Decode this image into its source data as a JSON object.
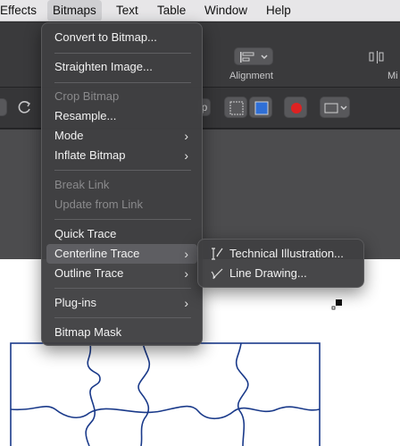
{
  "menubar": {
    "items": [
      "Effects",
      "Bitmaps",
      "Text",
      "Table",
      "Window",
      "Help"
    ]
  },
  "toolbar": {
    "alignment_label": "Alignment",
    "partial_label": "Mi",
    "partial_p": "p"
  },
  "bitmaps_menu": {
    "convert": "Convert to Bitmap...",
    "straighten": "Straighten Image...",
    "crop": "Crop Bitmap",
    "resample": "Resample...",
    "mode": "Mode",
    "inflate": "Inflate Bitmap",
    "break_link": "Break Link",
    "update_link": "Update from Link",
    "quick_trace": "Quick Trace",
    "centerline_trace": "Centerline Trace",
    "outline_trace": "Outline Trace",
    "plugins": "Plug-ins",
    "bitmap_mask": "Bitmap Mask",
    "chevron": "›"
  },
  "centerline_submenu": {
    "technical": "Technical Illustration...",
    "line_drawing": "Line Drawing..."
  },
  "colors": {
    "menu_bg": "#404042",
    "highlight": "#5e5e62",
    "puzzle_stroke": "#1a3a8a"
  }
}
